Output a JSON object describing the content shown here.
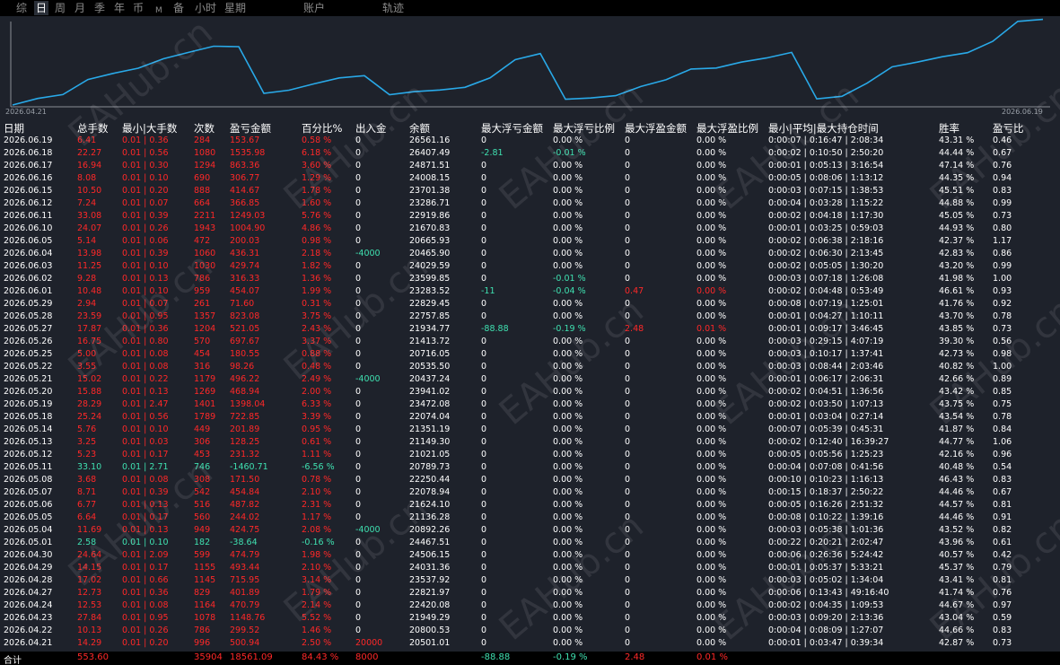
{
  "tabs": [
    {
      "label": "综",
      "active": false
    },
    {
      "label": "日",
      "active": true
    },
    {
      "label": "周",
      "active": false
    },
    {
      "label": "月",
      "active": false
    },
    {
      "label": "季",
      "active": false
    },
    {
      "label": "年",
      "active": false
    },
    {
      "label": "币",
      "active": false
    },
    {
      "label": "M",
      "active": false
    },
    {
      "label": "备",
      "active": false
    },
    {
      "label": "小时",
      "active": false
    },
    {
      "label": "星期",
      "active": false
    },
    {
      "label": "账户",
      "active": false
    },
    {
      "label": "轨迹",
      "active": false
    }
  ],
  "chart": {
    "start_label": "2026.04.21",
    "end_label": "2026.06.19",
    "line_color": "#29a9e8"
  },
  "headers": [
    "日期",
    "总手数",
    "最小|大手数",
    "次数",
    "盈亏金额",
    "百分比%",
    "出入金",
    "余额",
    "最大浮亏金额",
    "最大浮亏比例",
    "最大浮盈金额",
    "最大浮盈比例",
    "最小|平均|最大持仓时间",
    "胜率",
    "盈亏比"
  ],
  "rows": [
    [
      "2026.06.19",
      "6.41",
      "0.01 | 0.36",
      "284",
      "153.67",
      "0.58 %",
      "0",
      "26561.16",
      "0",
      "0.00 %",
      "0",
      "0.00 %",
      "0:00:07 | 0:16:47 | 2:08:34",
      "43.31 %",
      "0.46"
    ],
    [
      "2026.06.18",
      "22.27",
      "0.01 | 0.56",
      "1080",
      "1535.98",
      "6.18 %",
      "0",
      "26407.49",
      "-2.81",
      "-0.01 %",
      "0",
      "0.00 %",
      "0:00:02 | 0:10:50 | 2:50:20",
      "44.44 %",
      "0.67"
    ],
    [
      "2026.06.17",
      "16.94",
      "0.01 | 0.30",
      "1294",
      "863.36",
      "3.60 %",
      "0",
      "24871.51",
      "0",
      "0.00 %",
      "0",
      "0.00 %",
      "0:00:01 | 0:05:13 | 3:16:54",
      "47.14 %",
      "0.76"
    ],
    [
      "2026.06.16",
      "8.08",
      "0.01 | 0.10",
      "690",
      "306.77",
      "1.29 %",
      "0",
      "24008.15",
      "0",
      "0.00 %",
      "0",
      "0.00 %",
      "0:00:05 | 0:08:06 | 1:13:12",
      "44.35 %",
      "0.94"
    ],
    [
      "2026.06.15",
      "10.50",
      "0.01 | 0.20",
      "888",
      "414.67",
      "1.78 %",
      "0",
      "23701.38",
      "0",
      "0.00 %",
      "0",
      "0.00 %",
      "0:00:03 | 0:07:15 | 1:38:53",
      "45.51 %",
      "0.83"
    ],
    [
      "2026.06.12",
      "7.24",
      "0.01 | 0.07",
      "664",
      "366.85",
      "1.60 %",
      "0",
      "23286.71",
      "0",
      "0.00 %",
      "0",
      "0.00 %",
      "0:00:04 | 0:03:28 | 1:15:22",
      "44.88 %",
      "0.99"
    ],
    [
      "2026.06.11",
      "33.08",
      "0.01 | 0.39",
      "2211",
      "1249.03",
      "5.76 %",
      "0",
      "22919.86",
      "0",
      "0.00 %",
      "0",
      "0.00 %",
      "0:00:02 | 0:04:18 | 1:17:30",
      "45.05 %",
      "0.73"
    ],
    [
      "2026.06.10",
      "24.07",
      "0.01 | 0.26",
      "1943",
      "1004.90",
      "4.86 %",
      "0",
      "21670.83",
      "0",
      "0.00 %",
      "0",
      "0.00 %",
      "0:00:01 | 0:03:25 | 0:59:03",
      "44.93 %",
      "0.80"
    ],
    [
      "2026.06.05",
      "5.14",
      "0.01 | 0.06",
      "472",
      "200.03",
      "0.98 %",
      "0",
      "20665.93",
      "0",
      "0.00 %",
      "0",
      "0.00 %",
      "0:00:02 | 0:06:38 | 2:18:16",
      "42.37 %",
      "1.17"
    ],
    [
      "2026.06.04",
      "13.98",
      "0.01 | 0.39",
      "1060",
      "436.31",
      "2.18 %",
      "-4000",
      "20465.90",
      "0",
      "0.00 %",
      "0",
      "0.00 %",
      "0:00:02 | 0:06:30 | 2:13:45",
      "42.83 %",
      "0.86"
    ],
    [
      "2026.06.03",
      "11.25",
      "0.01 | 0.10",
      "1030",
      "429.74",
      "1.82 %",
      "0",
      "24029.59",
      "0",
      "0.00 %",
      "0",
      "0.00 %",
      "0:00:02 | 0:05:05 | 1:30:20",
      "43.20 %",
      "0.99"
    ],
    [
      "2026.06.02",
      "9.28",
      "0.01 | 0.13",
      "786",
      "316.33",
      "1.36 %",
      "0",
      "23599.85",
      "0",
      "-0.01 %",
      "0",
      "0.00 %",
      "0:00:03 | 0:07:18 | 1:26:08",
      "41.98 %",
      "1.00"
    ],
    [
      "2026.06.01",
      "10.48",
      "0.01 | 0.10",
      "959",
      "454.07",
      "1.99 %",
      "0",
      "23283.52",
      "-11",
      "-0.04 %",
      "0.47",
      "0.00 %",
      "0:00:02 | 0:04:48 | 0:53:49",
      "46.61 %",
      "0.93"
    ],
    [
      "2026.05.29",
      "2.94",
      "0.01 | 0.07",
      "261",
      "71.60",
      "0.31 %",
      "0",
      "22829.45",
      "0",
      "0.00 %",
      "0",
      "0.00 %",
      "0:00:08 | 0:07:19 | 1:25:01",
      "41.76 %",
      "0.92"
    ],
    [
      "2026.05.28",
      "23.59",
      "0.01 | 0.95",
      "1357",
      "823.08",
      "3.75 %",
      "0",
      "22757.85",
      "0",
      "0.00 %",
      "0",
      "0.00 %",
      "0:00:01 | 0:04:27 | 1:10:11",
      "43.70 %",
      "0.78"
    ],
    [
      "2026.05.27",
      "17.87",
      "0.01 | 0.36",
      "1204",
      "521.05",
      "2.43 %",
      "0",
      "21934.77",
      "-88.88",
      "-0.19 %",
      "2.48",
      "0.01 %",
      "0:00:01 | 0:09:17 | 3:46:45",
      "43.85 %",
      "0.73"
    ],
    [
      "2026.05.26",
      "16.75",
      "0.01 | 0.80",
      "570",
      "697.67",
      "3.37 %",
      "0",
      "21413.72",
      "0",
      "0.00 %",
      "0",
      "0.00 %",
      "0:00:03 | 0:29:15 | 4:07:19",
      "39.30 %",
      "0.56"
    ],
    [
      "2026.05.25",
      "5.00",
      "0.01 | 0.08",
      "454",
      "180.55",
      "0.88 %",
      "0",
      "20716.05",
      "0",
      "0.00 %",
      "0",
      "0.00 %",
      "0:00:03 | 0:10:17 | 1:37:41",
      "42.73 %",
      "0.98"
    ],
    [
      "2026.05.22",
      "3.55",
      "0.01 | 0.08",
      "316",
      "98.26",
      "0.48 %",
      "0",
      "20535.50",
      "0",
      "0.00 %",
      "0",
      "0.00 %",
      "0:00:03 | 0:08:44 | 2:03:46",
      "40.82 %",
      "1.00"
    ],
    [
      "2026.05.21",
      "15.02",
      "0.01 | 0.22",
      "1179",
      "496.22",
      "2.49 %",
      "-4000",
      "20437.24",
      "0",
      "0.00 %",
      "0",
      "0.00 %",
      "0:00:01 | 0:06:17 | 2:06:31",
      "42.66 %",
      "0.89"
    ],
    [
      "2026.05.20",
      "15.88",
      "0.01 | 0.13",
      "1269",
      "468.94",
      "2.00 %",
      "0",
      "23941.02",
      "0",
      "0.00 %",
      "0",
      "0.00 %",
      "0:00:02 | 0:04:51 | 1:36:56",
      "43.42 %",
      "0.85"
    ],
    [
      "2026.05.19",
      "28.29",
      "0.01 | 2.47",
      "1401",
      "1398.04",
      "6.33 %",
      "0",
      "23472.08",
      "0",
      "0.00 %",
      "0",
      "0.00 %",
      "0:00:02 | 0:03:50 | 1:07:13",
      "43.75 %",
      "0.75"
    ],
    [
      "2026.05.18",
      "25.24",
      "0.01 | 0.56",
      "1789",
      "722.85",
      "3.39 %",
      "0",
      "22074.04",
      "0",
      "0.00 %",
      "0",
      "0.00 %",
      "0:00:01 | 0:03:04 | 0:27:14",
      "43.54 %",
      "0.78"
    ],
    [
      "2026.05.14",
      "5.76",
      "0.01 | 0.10",
      "449",
      "201.89",
      "0.95 %",
      "0",
      "21351.19",
      "0",
      "0.00 %",
      "0",
      "0.00 %",
      "0:00:07 | 0:05:39 | 0:45:31",
      "41.87 %",
      "0.84"
    ],
    [
      "2026.05.13",
      "3.25",
      "0.01 | 0.03",
      "306",
      "128.25",
      "0.61 %",
      "0",
      "21149.30",
      "0",
      "0.00 %",
      "0",
      "0.00 %",
      "0:00:02 | 0:12:40 | 16:39:27",
      "44.77 %",
      "1.06"
    ],
    [
      "2026.05.12",
      "5.23",
      "0.01 | 0.17",
      "453",
      "231.32",
      "1.11 %",
      "0",
      "21021.05",
      "0",
      "0.00 %",
      "0",
      "0.00 %",
      "0:00:05 | 0:05:56 | 1:25:23",
      "42.16 %",
      "0.96"
    ],
    [
      "2026.05.11",
      "33.10",
      "0.01 | 2.71",
      "746",
      "-1460.71",
      "-6.56 %",
      "0",
      "20789.73",
      "0",
      "0.00 %",
      "0",
      "0.00 %",
      "0:00:04 | 0:07:08 | 0:41:56",
      "40.48 %",
      "0.54"
    ],
    [
      "2026.05.08",
      "3.68",
      "0.01 | 0.08",
      "308",
      "171.50",
      "0.78 %",
      "0",
      "22250.44",
      "0",
      "0.00 %",
      "0",
      "0.00 %",
      "0:00:10 | 0:10:23 | 1:16:13",
      "46.43 %",
      "0.83"
    ],
    [
      "2026.05.07",
      "8.71",
      "0.01 | 0.39",
      "542",
      "454.84",
      "2.10 %",
      "0",
      "22078.94",
      "0",
      "0.00 %",
      "0",
      "0.00 %",
      "0:00:15 | 0:18:37 | 2:50:22",
      "44.46 %",
      "0.67"
    ],
    [
      "2026.05.06",
      "6.77",
      "0.01 | 0.13",
      "516",
      "487.82",
      "2.31 %",
      "0",
      "21624.10",
      "0",
      "0.00 %",
      "0",
      "0.00 %",
      "0:00:05 | 0:16:26 | 2:51:32",
      "44.57 %",
      "0.81"
    ],
    [
      "2026.05.05",
      "6.64",
      "0.01 | 0.17",
      "560",
      "244.02",
      "1.17 %",
      "0",
      "21136.28",
      "0",
      "0.00 %",
      "0",
      "0.00 %",
      "0:00:08 | 0:10:22 | 1:39:16",
      "44.46 %",
      "0.91"
    ],
    [
      "2026.05.04",
      "11.69",
      "0.01 | 0.13",
      "949",
      "424.75",
      "2.08 %",
      "-4000",
      "20892.26",
      "0",
      "0.00 %",
      "0",
      "0.00 %",
      "0:00:03 | 0:05:38 | 1:01:36",
      "43.52 %",
      "0.82"
    ],
    [
      "2026.05.01",
      "2.58",
      "0.01 | 0.10",
      "182",
      "-38.64",
      "-0.16 %",
      "0",
      "24467.51",
      "0",
      "0.00 %",
      "0",
      "0.00 %",
      "0:00:22 | 0:20:21 | 2:02:47",
      "43.96 %",
      "0.61"
    ],
    [
      "2026.04.30",
      "24.64",
      "0.01 | 2.09",
      "599",
      "474.79",
      "1.98 %",
      "0",
      "24506.15",
      "0",
      "0.00 %",
      "0",
      "0.00 %",
      "0:00:06 | 0:26:36 | 5:24:42",
      "40.57 %",
      "0.42"
    ],
    [
      "2026.04.29",
      "14.15",
      "0.01 | 0.17",
      "1155",
      "493.44",
      "2.10 %",
      "0",
      "24031.36",
      "0",
      "0.00 %",
      "0",
      "0.00 %",
      "0:00:01 | 0:05:37 | 5:33:21",
      "45.37 %",
      "0.79"
    ],
    [
      "2026.04.28",
      "17.02",
      "0.01 | 0.66",
      "1145",
      "715.95",
      "3.14 %",
      "0",
      "23537.92",
      "0",
      "0.00 %",
      "0",
      "0.00 %",
      "0:00:03 | 0:05:02 | 1:34:04",
      "43.41 %",
      "0.81"
    ],
    [
      "2026.04.27",
      "12.73",
      "0.01 | 0.36",
      "829",
      "401.89",
      "1.79 %",
      "0",
      "22821.97",
      "0",
      "0.00 %",
      "0",
      "0.00 %",
      "0:00:06 | 0:13:43 | 49:16:40",
      "41.74 %",
      "0.76"
    ],
    [
      "2026.04.24",
      "12.53",
      "0.01 | 0.08",
      "1164",
      "470.79",
      "2.14 %",
      "0",
      "22420.08",
      "0",
      "0.00 %",
      "0",
      "0.00 %",
      "0:00:02 | 0:04:35 | 1:09:53",
      "44.67 %",
      "0.97"
    ],
    [
      "2026.04.23",
      "27.84",
      "0.01 | 0.95",
      "1078",
      "1148.76",
      "5.52 %",
      "0",
      "21949.29",
      "0",
      "0.00 %",
      "0",
      "0.00 %",
      "0:00:03 | 0:09:20 | 2:13:36",
      "43.04 %",
      "0.59"
    ],
    [
      "2026.04.22",
      "10.13",
      "0.01 | 0.26",
      "786",
      "299.52",
      "1.46 %",
      "0",
      "20800.53",
      "0",
      "0.00 %",
      "0",
      "0.00 %",
      "0:00:04 | 0:08:09 | 1:27:07",
      "44.66 %",
      "0.83"
    ],
    [
      "2026.04.21",
      "14.29",
      "0.01 | 0.20",
      "996",
      "500.94",
      "2.50 %",
      "20000",
      "20501.01",
      "0",
      "0.00 %",
      "0",
      "0.00 %",
      "0:00:01 | 0:03:47 | 0:39:34",
      "42.87 %",
      "0.73"
    ]
  ],
  "total": {
    "label": "合计",
    "lots": "553.60",
    "count": "35904",
    "pnl": "18561.09",
    "pct": "84.43 %",
    "flow": "8000",
    "max_float_loss": "-88.88",
    "max_float_loss_pct": "-0.19 %",
    "max_float_profit": "2.48",
    "max_float_profit_pct": "0.01 %"
  },
  "watermark": "EAHub.cn"
}
